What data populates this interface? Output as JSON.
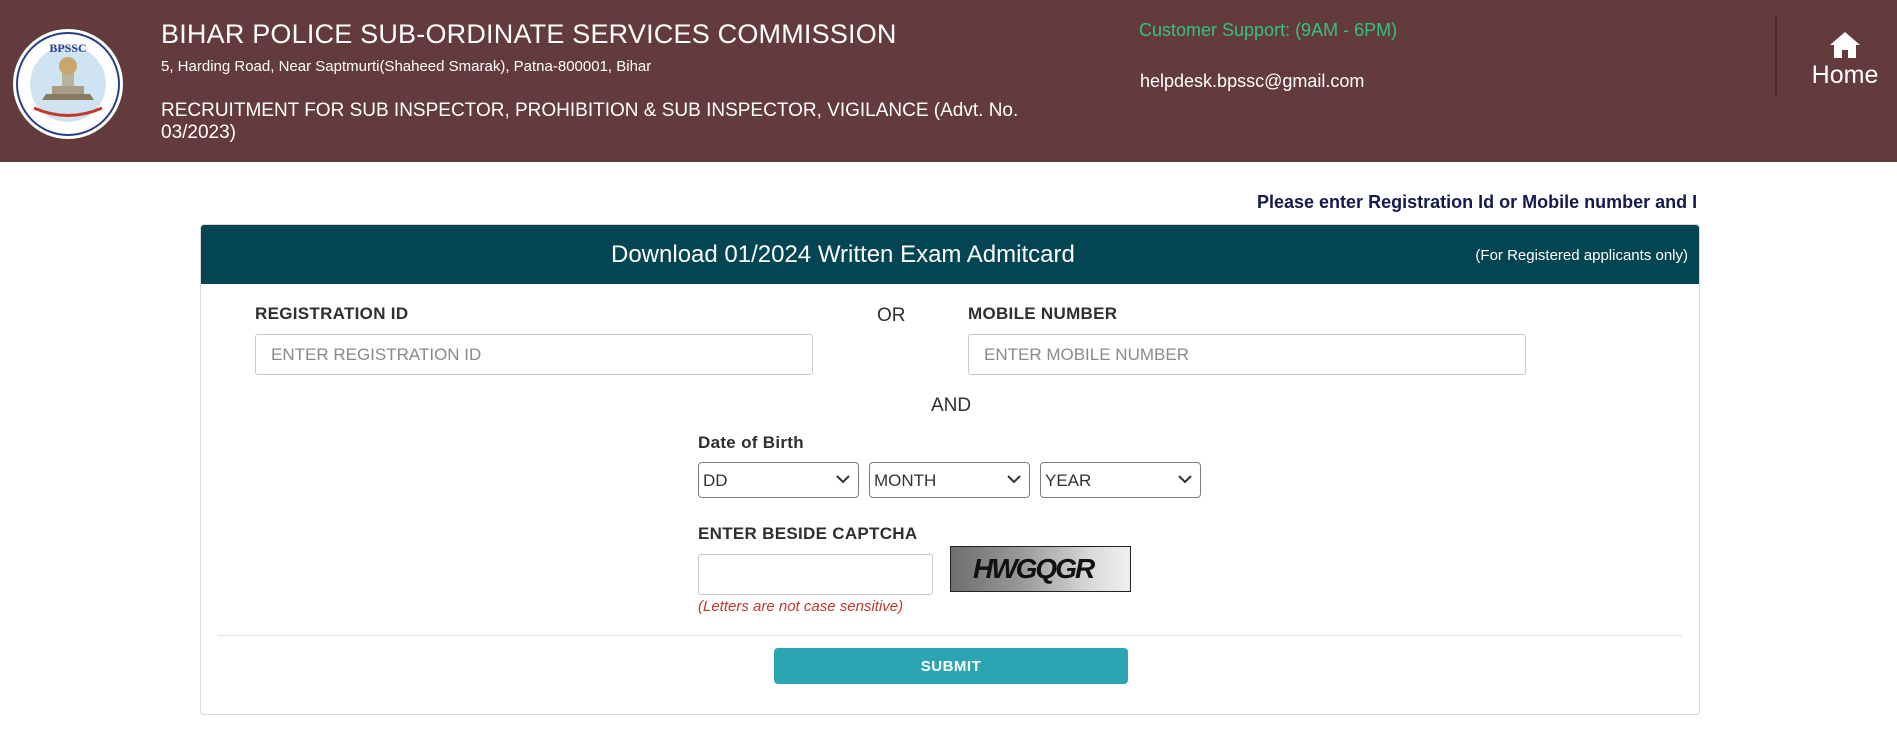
{
  "header": {
    "logo_text": "BPSSC",
    "title": "BIHAR POLICE SUB-ORDINATE SERVICES COMMISSION",
    "address": "5, Harding Road, Near Saptmurti(Shaheed Smarak), Patna-800001, Bihar",
    "recruitment": "RECRUITMENT FOR SUB INSPECTOR, PROHIBITION & SUB INSPECTOR, VIGILANCE (Advt. No. 03/2023)",
    "support": "Customer Support: (9AM - 6PM)",
    "email": "helpdesk.bpssc@gmail.com",
    "home_label": "Home",
    "colors": {
      "background": "#643b3d",
      "support_text": "#34c27a"
    }
  },
  "marquee": "Please enter Registration Id or Mobile number and I",
  "card": {
    "title": "Download 01/2024 Written Exam Admitcard",
    "note": "(For Registered applicants only)",
    "header_color": "#034552",
    "registration": {
      "label": "REGISTRATION ID",
      "placeholder": "ENTER REGISTRATION ID"
    },
    "or_text": "OR",
    "mobile": {
      "label": "MOBILE NUMBER",
      "placeholder": "ENTER MOBILE NUMBER"
    },
    "and_text": "AND",
    "dob": {
      "label": "Date of Birth",
      "day": "DD",
      "month": "MONTH",
      "year": "YEAR"
    },
    "captcha": {
      "label": "ENTER BESIDE CAPTCHA",
      "value": "",
      "image_text": "HWGQGR",
      "hint": "(Letters are not case sensitive)"
    },
    "submit_label": "SUBMIT",
    "submit_color": "#2aa5b1"
  }
}
